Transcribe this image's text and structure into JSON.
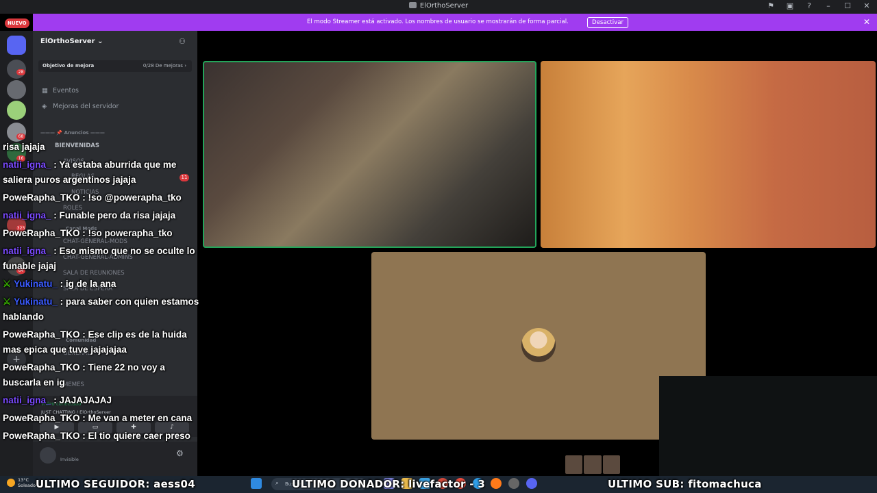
{
  "window": {
    "title": "ElOrthoServer"
  },
  "rail": {
    "nuevo_label": "NUEVO",
    "badges": [
      "28",
      "68",
      "16",
      "323",
      "64"
    ]
  },
  "banner": {
    "message": "El modo Streamer está activado. Los nombres de usuario se mostrarán de forma parcial.",
    "button": "Desactivar"
  },
  "server": {
    "name": "ElOrthoServer",
    "boost_goal": "Objetivo de mejora",
    "boost_count": "0/28 De mejoras",
    "items": [
      {
        "label": "Eventos",
        "icon": "calendar-icon"
      },
      {
        "label": "Mejoras del servidor",
        "icon": "boost-icon"
      }
    ],
    "categories": [
      {
        "label": "——— 📌 Anuncios ———"
      },
      {
        "label": "Canal Mods"
      },
      {
        "label": "Comunidad"
      }
    ],
    "channels": [
      "BIENVENIDAS",
      "AVISOS",
      "REGLAS",
      "NOTICIAS",
      "ROLES",
      "CHAT-GENERAL-MODS",
      "CHAT-GENERAL-ADMINS",
      "SALA DE REUNIONES",
      "SALA DE ESPERA",
      "MEMES",
      "GENERAL"
    ],
    "channel_badge": "11",
    "voice": {
      "status": "Video conectado",
      "location": "JUST CHATTING / ElOrthoServer"
    },
    "user_status": "Invisible"
  },
  "chat": [
    {
      "user": "",
      "text": "risa jajaja",
      "style": "w"
    },
    {
      "user": "natii_igna_",
      "text": " : Ya estaba aburrida que me saliera puros argentinos jajaja",
      "style": "p"
    },
    {
      "user": "PoweRapha_TKO",
      "text": " : !so @powerapha_tko",
      "style": "w"
    },
    {
      "user": "natii_igna_",
      "text": " : Funable pero da risa jajaja",
      "style": "p"
    },
    {
      "user": "PoweRapha_TKO",
      "text": " : !so powerapha_tko",
      "style": "w"
    },
    {
      "user": "natii_igna_",
      "text": " : Eso mismo que no se oculte lo funable jajaj",
      "style": "p"
    },
    {
      "user": "Yukinatu_",
      "text": " : ig de la ana",
      "style": "b",
      "sword": true
    },
    {
      "user": "Yukinatu_",
      "text": " : para saber con quien estamos hablando",
      "style": "b",
      "sword": true
    },
    {
      "user": "PoweRapha_TKO",
      "text": " : Ese clip es de la huida mas epica que tuve jajajajaa",
      "style": "w"
    },
    {
      "user": "PoweRapha_TKO",
      "text": " : Tiene 22 no voy a buscarla en ig",
      "style": "w"
    },
    {
      "user": "natii_igna_",
      "text": " : JAJAJAJAJ",
      "style": "p"
    },
    {
      "user": "PoweRapha_TKO",
      "text": " : Me van a meter en cana",
      "style": "w"
    },
    {
      "user": "PoweRapha_TKO",
      "text": " : El tio quiere caer preso",
      "style": "w"
    }
  ],
  "stats": {
    "seguidor": "ULTIMO SEGUIDOR: aess04",
    "donador": "ULTIMO DONADOR: livefactor - 3",
    "sub": "ULTIMO SUB: fitomachuca"
  },
  "taskbar": {
    "temp": "13°C",
    "weather": "Soleado",
    "search_placeholder": "Buscar"
  },
  "colors": {
    "banner": "#a03cf0",
    "speaking": "#23a55a",
    "username": "#7b4bff"
  }
}
